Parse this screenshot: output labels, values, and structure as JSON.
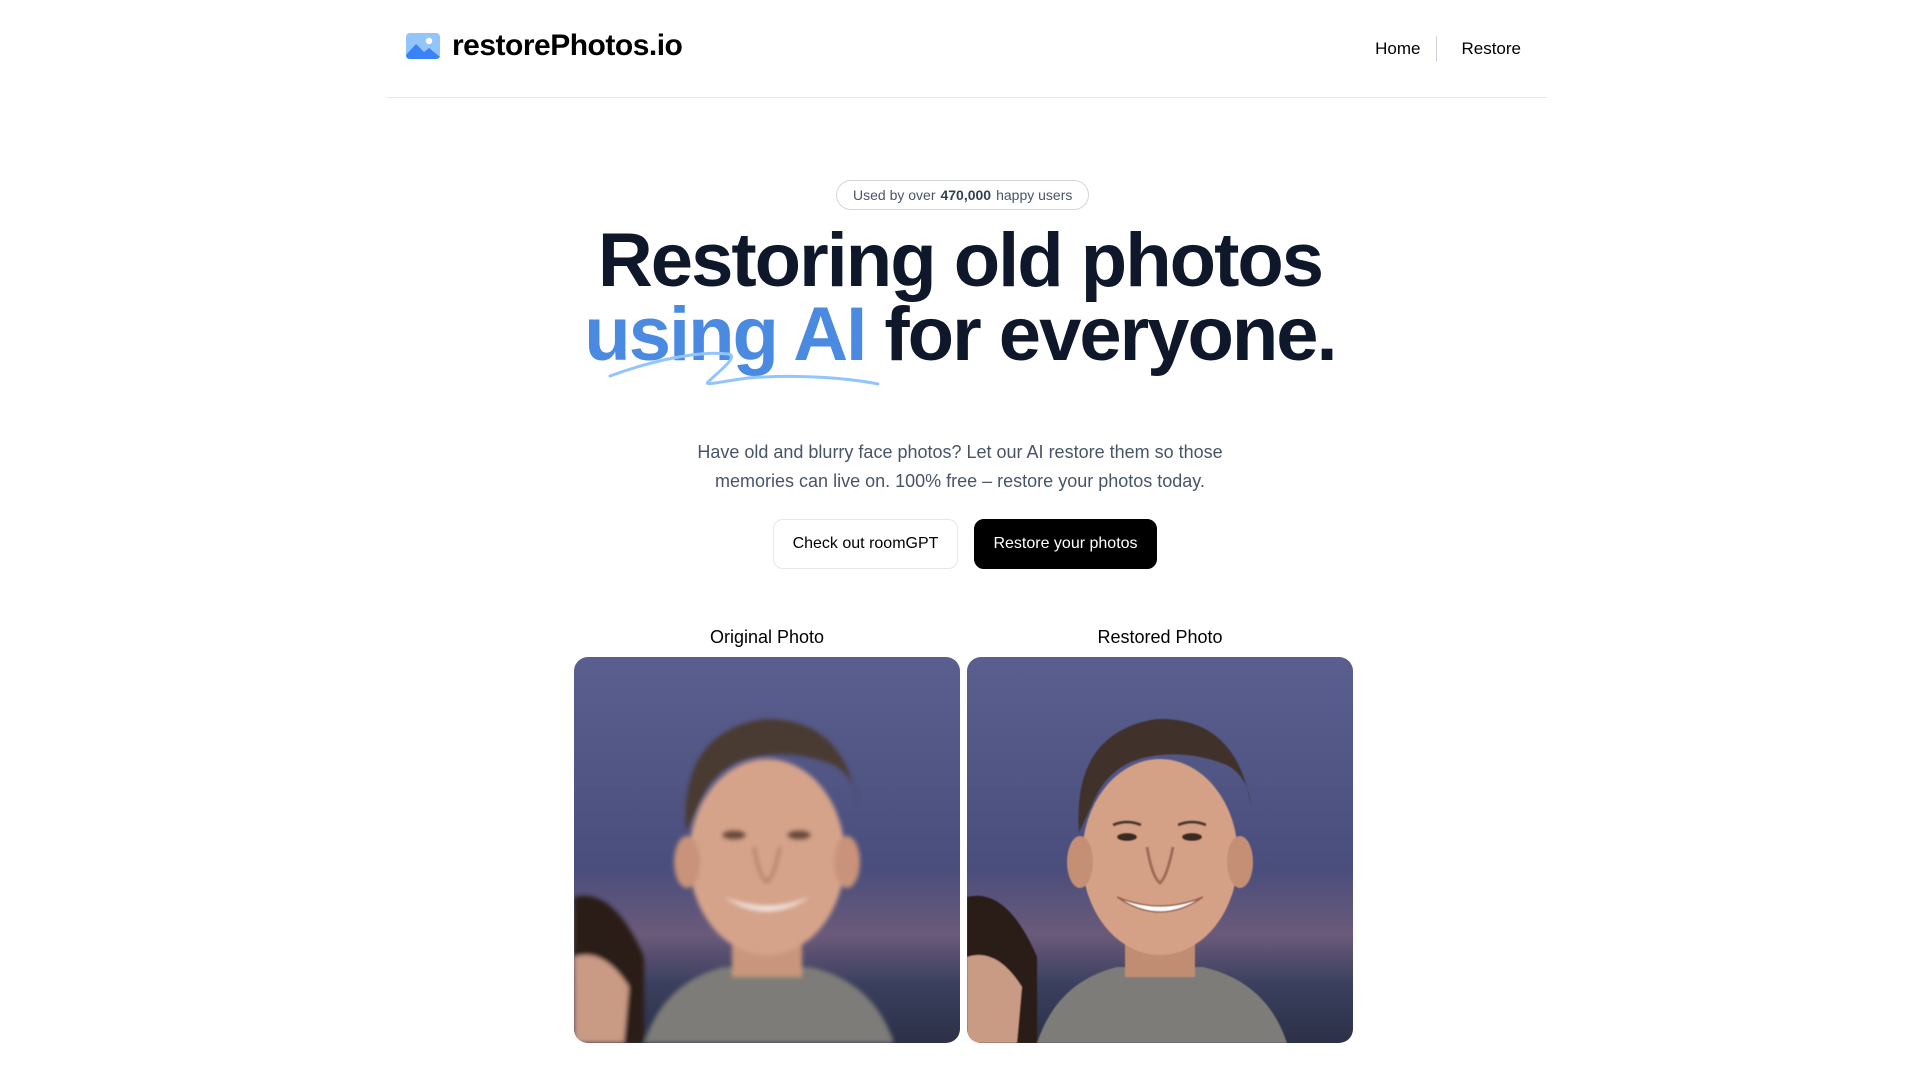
{
  "header": {
    "brand": "restorePhotos.io",
    "logo_icon": "image-icon",
    "nav": [
      {
        "label": "Home"
      },
      {
        "label": "Restore"
      }
    ]
  },
  "hero": {
    "badge": {
      "prefix": "Used by over",
      "count": "470,000",
      "suffix": "happy users"
    },
    "headline_line1": "Restoring old photos",
    "headline_accent": "using AI",
    "headline_rest": "for everyone.",
    "subtitle_line1": "Have old and blurry face photos? Let our AI restore them so those",
    "subtitle_line2": "memories can live on. 100% free – restore your photos today.",
    "cta_secondary": "Check out roomGPT",
    "cta_primary": "Restore your photos"
  },
  "comparison": {
    "original_label": "Original Photo",
    "restored_label": "Restored Photo"
  },
  "colors": {
    "accent": "#4a8ae0",
    "text": "#0f172a",
    "muted": "#475569"
  }
}
